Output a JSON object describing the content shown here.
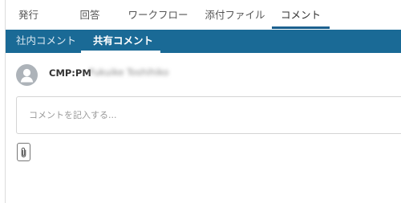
{
  "tabs": [
    {
      "label": "発行"
    },
    {
      "label": "回答"
    },
    {
      "label": "ワークフロー"
    },
    {
      "label": "添付ファイル"
    },
    {
      "label": "コメント",
      "active": true
    }
  ],
  "subtabs": [
    {
      "label": "社内コメント"
    },
    {
      "label": "共有コメント",
      "active": true
    }
  ],
  "comment": {
    "author_prefix": "CMP:PM",
    "author_name": "Fukuike Toshihiko",
    "placeholder": "コメントを記入する...",
    "avatar_icon": "user-avatar-icon",
    "attach_icon": "paperclip-icon"
  },
  "colors": {
    "accent": "#1a6a96",
    "tab_underline": "#1a5f8e",
    "avatar_bg": "#adb3b9"
  }
}
